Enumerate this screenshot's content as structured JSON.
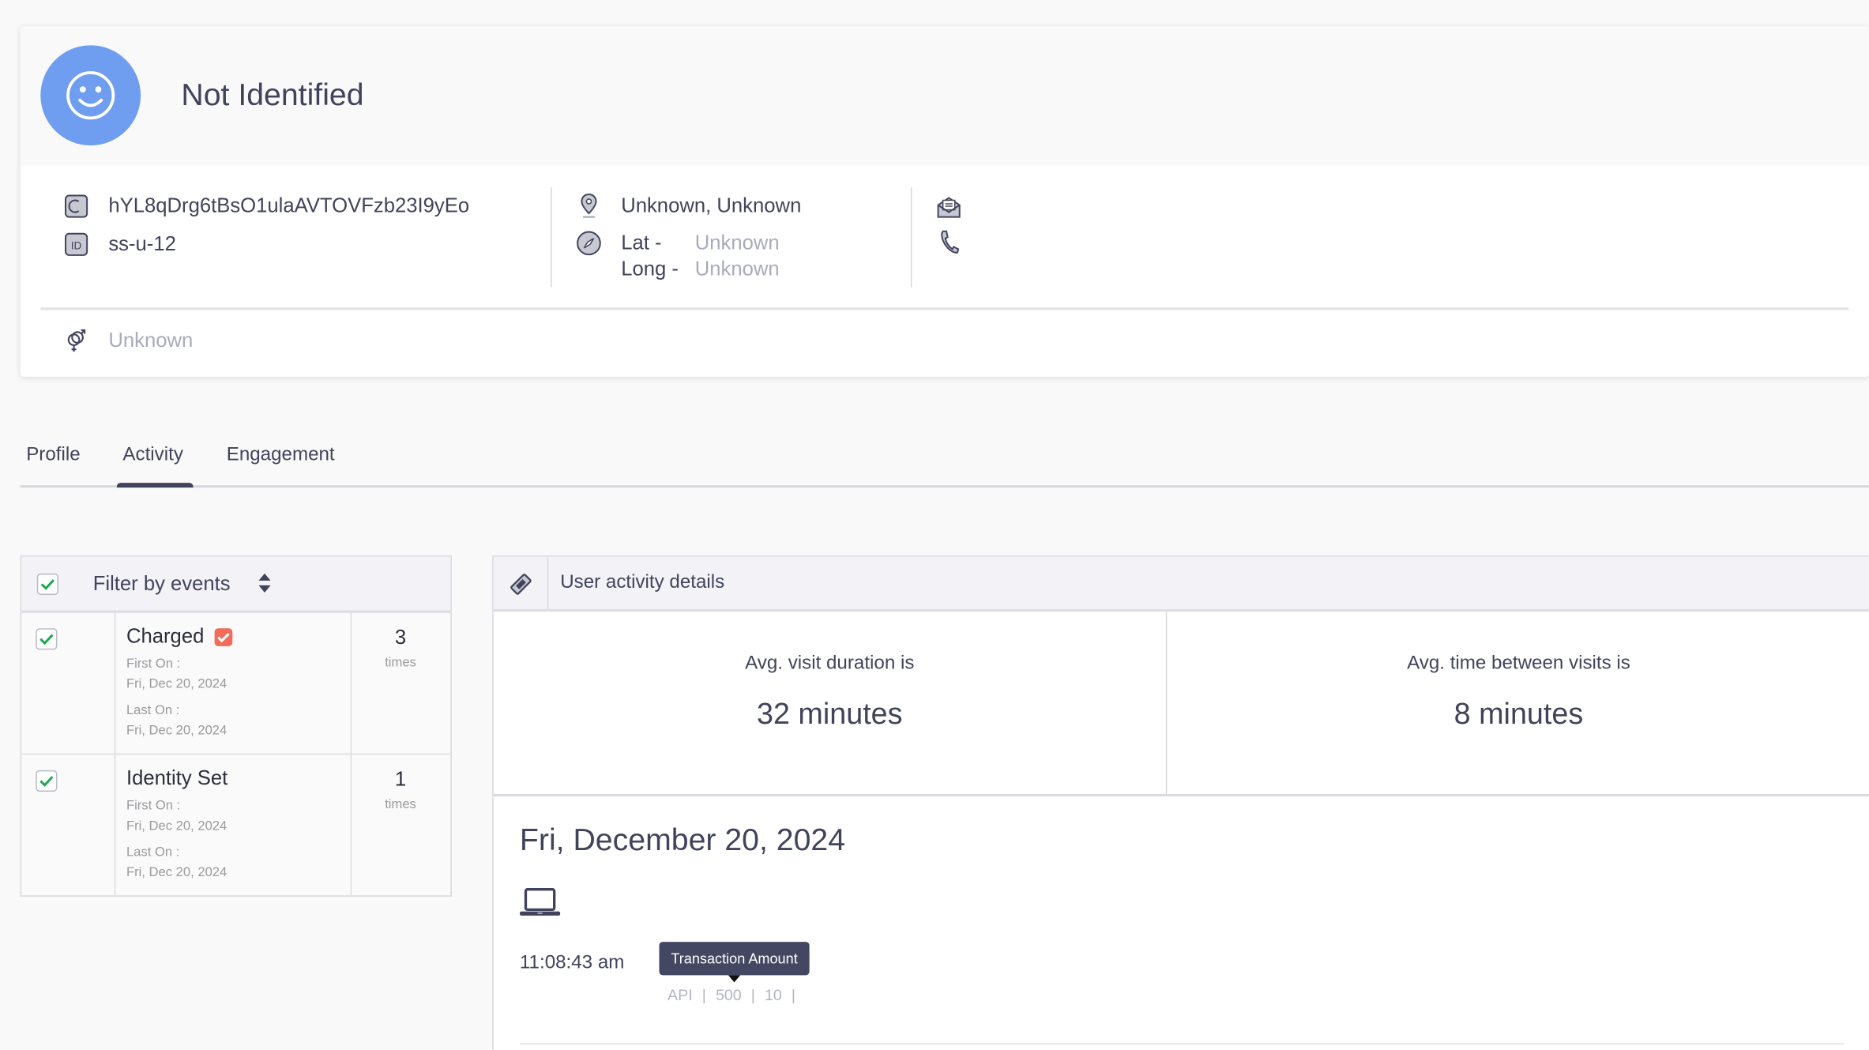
{
  "profile": {
    "title": "Not Identified",
    "avatar_icon": "smiley-face-icon",
    "avatar_color": "#6f9ef0",
    "guid": "hYL8qDrg6tBsO1ulaAVTOVFzb23I9yEo",
    "identity": "ss-u-12",
    "location": "Unknown, Unknown",
    "lat_label": "Lat -",
    "lat_value": "Unknown",
    "long_label": "Long -",
    "long_value": "Unknown",
    "email_icon": "email-icon",
    "phone_icon": "phone-icon",
    "gender": "Unknown"
  },
  "tabs": [
    {
      "label": "Profile",
      "active": false
    },
    {
      "label": "Activity",
      "active": true
    },
    {
      "label": "Engagement",
      "active": false
    }
  ],
  "filter": {
    "title": "Filter by events",
    "all_checked": true,
    "events": [
      {
        "name": "Charged",
        "badge": true,
        "checked": true,
        "first_on_label": "First On :",
        "first_on": "Fri, Dec 20, 2024",
        "last_on_label": "Last On :",
        "last_on": "Fri, Dec 20, 2024",
        "count": "3",
        "count_unit": "times"
      },
      {
        "name": "Identity Set",
        "badge": false,
        "checked": true,
        "first_on_label": "First On :",
        "first_on": "Fri, Dec 20, 2024",
        "last_on_label": "Last On :",
        "last_on": "Fri, Dec 20, 2024",
        "count": "1",
        "count_unit": "times"
      }
    ]
  },
  "activity": {
    "title": "User activity details",
    "stats": [
      {
        "label": "Avg. visit duration is",
        "value": "32 minutes"
      },
      {
        "label": "Avg. time between visits is",
        "value": "8 minutes"
      }
    ],
    "date": "Fri, December 20, 2024",
    "device_icon": "laptop-icon",
    "entries": [
      {
        "time": "11:08:43 am",
        "tooltip": "Transaction Amount",
        "props": [
          "API",
          "|",
          "500",
          "|",
          "10",
          "|"
        ]
      }
    ]
  },
  "colors": {
    "accent": "#41435c",
    "check_green": "#1fa84f",
    "badge_red": "#f26b5b"
  }
}
